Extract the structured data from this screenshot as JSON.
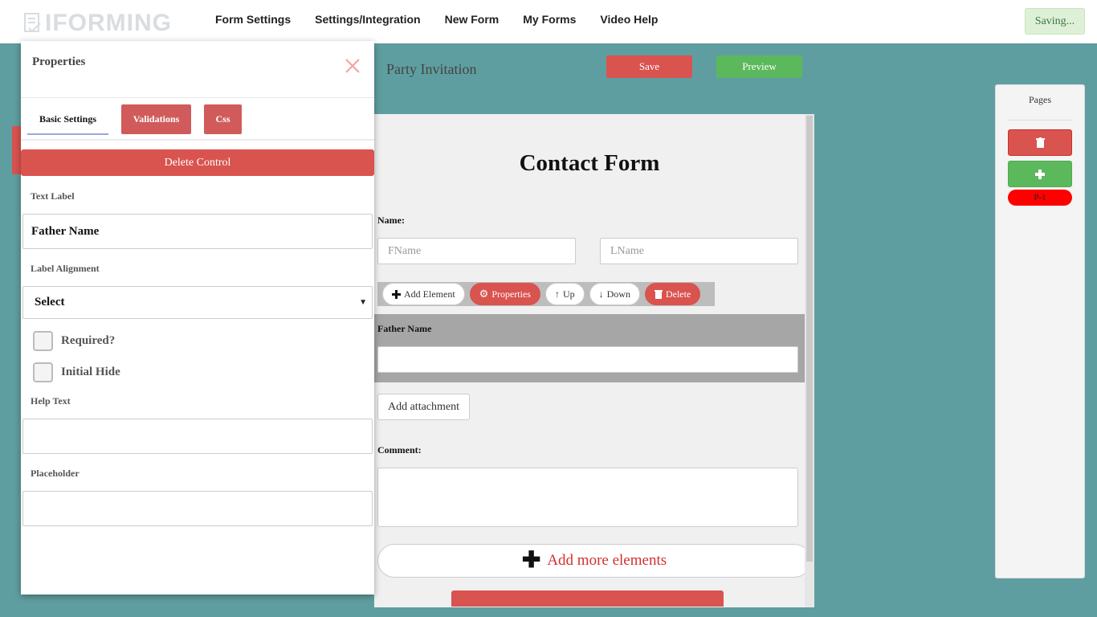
{
  "brand": {
    "logo_text": "IFORMING"
  },
  "nav": {
    "items": [
      "Form Settings",
      "Settings/Integration",
      "New Form",
      "My Forms",
      "Video Help"
    ],
    "status": "Saving..."
  },
  "header": {
    "form_name": "Party Invitation",
    "save_label": "Save",
    "preview_label": "Preview"
  },
  "canvas": {
    "title": "Contact Form",
    "name_label": "Name:",
    "fname_placeholder": "FName",
    "lname_placeholder": "LName",
    "toolbar": {
      "add_element": "Add Element",
      "properties": "Properties",
      "up": "Up",
      "down": "Down",
      "delete": "Delete"
    },
    "selected_field_label": "Father Name",
    "attachment_label": "Add attachment",
    "comment_label": "Comment:",
    "add_more_label": "Add more elements"
  },
  "pages_panel": {
    "title": "Pages",
    "page_label": "P-1"
  },
  "properties": {
    "title": "Properties",
    "tabs": {
      "basic": "Basic Settings",
      "validations": "Validations",
      "css": "Css"
    },
    "delete_control": "Delete Control",
    "text_label_caption": "Text Label",
    "text_label_value": "Father Name",
    "alignment_caption": "Label Alignment",
    "alignment_value": "Select",
    "required_label": "Required?",
    "initial_hide_label": "Initial Hide",
    "help_text_caption": "Help Text",
    "placeholder_caption": "Placeholder"
  },
  "colors": {
    "background": "#5f9ea0",
    "danger": "#d9534f",
    "success": "#5cb85c",
    "page_badge": "#ff0000"
  }
}
